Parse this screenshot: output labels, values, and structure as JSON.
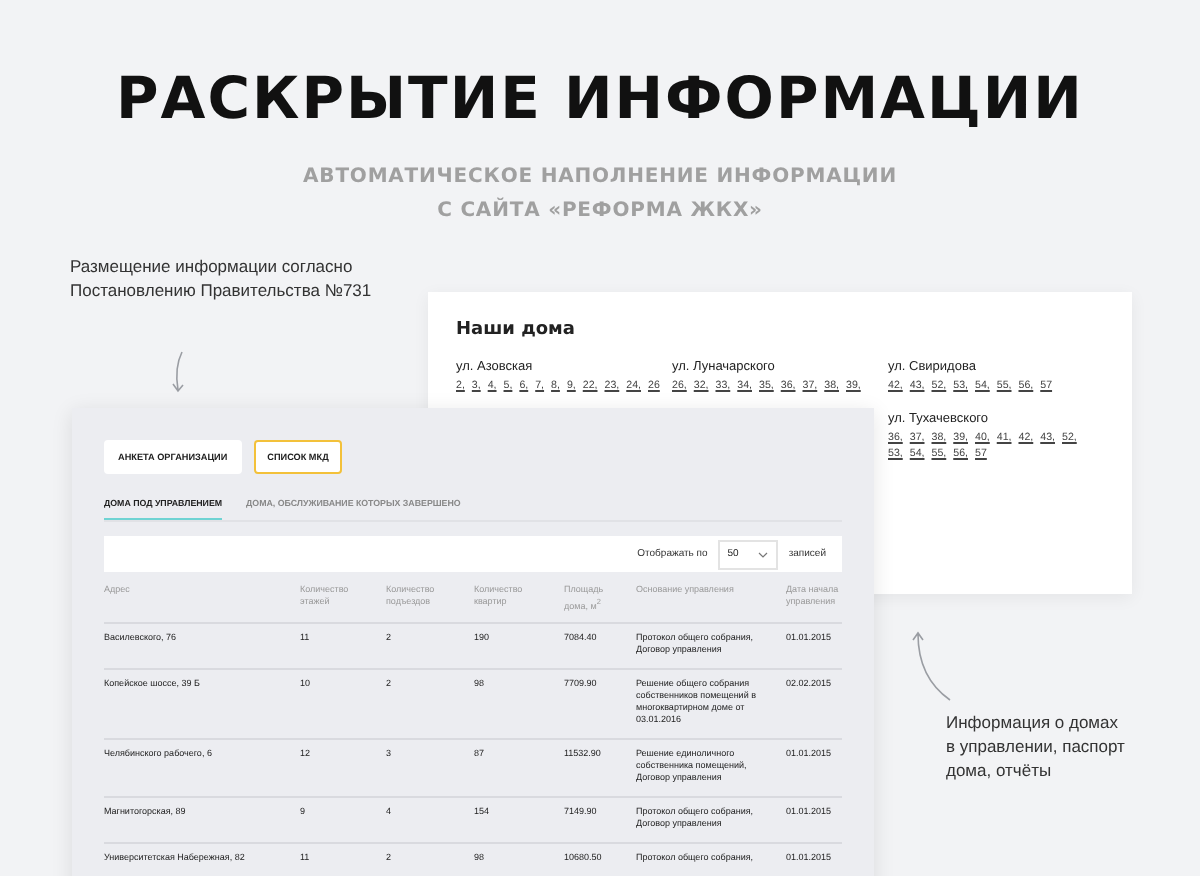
{
  "title": "РАСКРЫТИЕ ИНФОРМАЦИИ",
  "subtitle": [
    "АВТОМАТИЧЕСКОЕ НАПОЛНЕНИЕ ИНФОРМАЦИИ",
    "С САЙТА «РЕФОРМА ЖКХ»"
  ],
  "note_left": [
    "Размещение информации согласно",
    "Постановлению Правительства №731"
  ],
  "note_right": [
    "Информация о домах",
    "в управлении, паспорт",
    "дома, отчёты"
  ],
  "houses": {
    "title": "Наши дома",
    "columns": [
      [
        {
          "street": "ул. Азовская",
          "numbers": [
            "2,",
            "3,",
            "4,",
            "5,",
            "6,",
            "7,",
            "8,",
            "9,",
            "22,",
            "23,",
            "24,",
            "26"
          ]
        }
      ],
      [
        {
          "street": "ул. Луначарского",
          "numbers": [
            "26,",
            "32,",
            "33,",
            "34,",
            "35,",
            "36,",
            "37,",
            "38,",
            "39,"
          ]
        }
      ],
      [
        {
          "street": "ул. Свиридова",
          "numbers": [
            "42,",
            "43,",
            "52,",
            "53,",
            "54,",
            "55,",
            "56,",
            "57"
          ]
        },
        {
          "street": "ул. Тухачевского",
          "numbers": [
            "36,",
            "37,",
            "38,",
            "39,",
            "40,",
            "41,",
            "42,",
            "43,",
            "52,",
            "53,",
            "54,",
            "55,",
            "56,",
            "57"
          ]
        }
      ]
    ]
  },
  "tabs": [
    {
      "label": "АНКЕТА ОРГАНИЗАЦИИ",
      "selected": false
    },
    {
      "label": "СПИСОК МКД",
      "selected": true
    }
  ],
  "subtabs": [
    {
      "label": "ДОМА ПОД УПРАВЛЕНИЕМ",
      "selected": true
    },
    {
      "label": "ДОМА, ОБСЛУЖИВАНИЕ КОТОРЫХ ЗАВЕРШЕНО",
      "selected": false
    }
  ],
  "page_size": {
    "label": "Отображать по",
    "value": "50",
    "suffix": "записей"
  },
  "table": {
    "columns": [
      "Адрес",
      "Количество этажей",
      "Количество подъездов",
      "Количество квартир",
      "Площадь дома, м$^{2}$",
      "Основание управления",
      "Дата начала управления"
    ],
    "rows": [
      [
        "Василевского, 76",
        "11",
        "2",
        "190",
        "7084.40",
        "Протокол общего собрания, Договор управления",
        "01.01.2015"
      ],
      [
        "Копейское шоссе, 39 Б",
        "10",
        "2",
        "98",
        "7709.90",
        "Решение общего собрания собственников помещений в многоквартирном доме от 03.01.2016",
        "02.02.2015"
      ],
      [
        "Челябинского рабочего, 6",
        "12",
        "3",
        "87",
        "11532.90",
        "Решение единоличного собственника помещений, Договор управления",
        "01.01.2015"
      ],
      [
        "Магнитогорская, 89",
        "9",
        "4",
        "154",
        "7149.90",
        "Протокол общего собрания, Договор управления",
        "01.01.2015"
      ],
      [
        "Университетская Набережная, 82",
        "11",
        "2",
        "98",
        "10680.50",
        "Протокол общего собрания,",
        "01.01.2015"
      ]
    ]
  }
}
